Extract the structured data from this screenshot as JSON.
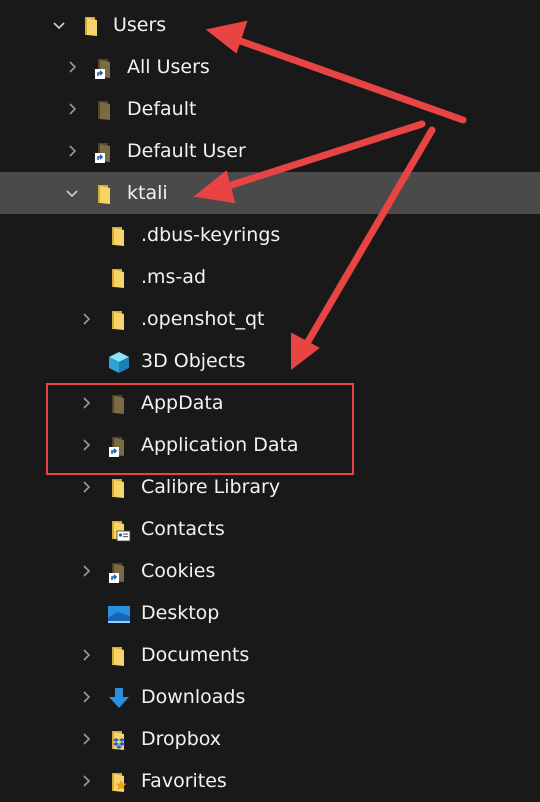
{
  "tree": {
    "users": {
      "label": "Users",
      "expanded": true
    },
    "children": [
      {
        "label": "All Users",
        "icon": "folder-shortcut-icon"
      },
      {
        "label": "Default",
        "icon": "folder-dark-icon"
      },
      {
        "label": "Default User",
        "icon": "folder-shortcut-icon"
      },
      {
        "label": "ktali",
        "icon": "folder-icon",
        "expanded": true,
        "selected": true
      }
    ],
    "ktali_children": [
      {
        "label": ".dbus-keyrings",
        "icon": "folder-icon"
      },
      {
        "label": ".ms-ad",
        "icon": "folder-icon"
      },
      {
        "label": ".openshot_qt",
        "icon": "folder-icon"
      },
      {
        "label": "3D Objects",
        "icon": "3d-objects-icon"
      },
      {
        "label": "AppData",
        "icon": "folder-dark-icon"
      },
      {
        "label": "Application Data",
        "icon": "folder-shortcut-icon"
      },
      {
        "label": "Calibre Library",
        "icon": "folder-icon"
      },
      {
        "label": "Contacts",
        "icon": "contacts-icon"
      },
      {
        "label": "Cookies",
        "icon": "folder-shortcut-icon"
      },
      {
        "label": "Desktop",
        "icon": "desktop-icon"
      },
      {
        "label": "Documents",
        "icon": "folder-icon"
      },
      {
        "label": "Downloads",
        "icon": "downloads-icon"
      },
      {
        "label": "Dropbox",
        "icon": "dropbox-icon"
      },
      {
        "label": "Favorites",
        "icon": "favorites-icon"
      }
    ]
  },
  "colors": {
    "background": "#191919",
    "selected_row": "#4a4a4a",
    "annotation_red": "#e84444",
    "folder_yellow": "#f4c542",
    "folder_dark": "#6e6240"
  }
}
